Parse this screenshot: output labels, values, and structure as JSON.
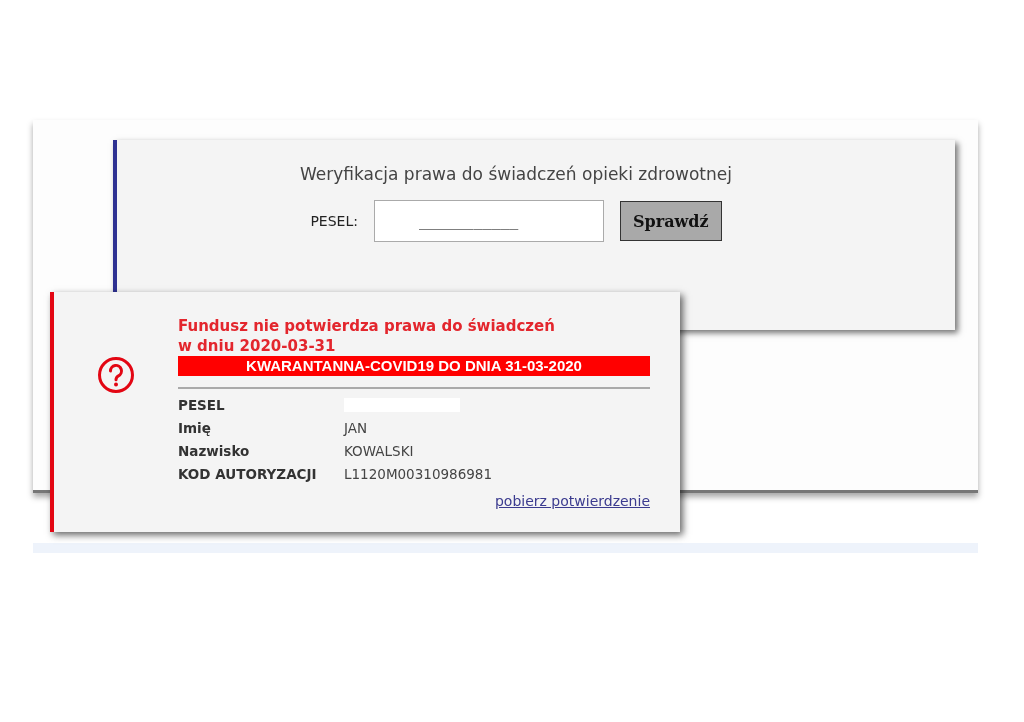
{
  "form": {
    "title": "Weryfikacja prawa do świadczeń opieki zdrowotnej",
    "pesel_label": "PESEL:",
    "pesel_value": "___________",
    "button": "Sprawdź"
  },
  "result": {
    "message_lines": [
      "Fundusz nie potwierdza prawa do świadczeń",
      "w dniu 2020-03-31"
    ],
    "banner": "KWARANTANNA-COVID19 DO DNIA 31-03-2020",
    "details": [
      {
        "label": "PESEL",
        "redacted": true
      },
      {
        "label": "Imię",
        "value": "JAN",
        "redacted": false
      },
      {
        "label": "Nazwisko",
        "value": "KOWALSKI",
        "redacted": false
      },
      {
        "label": "KOD AUTORYZACJI",
        "value": "L1120M00310986981",
        "redacted": false
      }
    ],
    "link": "pobierz potwierdzenie"
  }
}
